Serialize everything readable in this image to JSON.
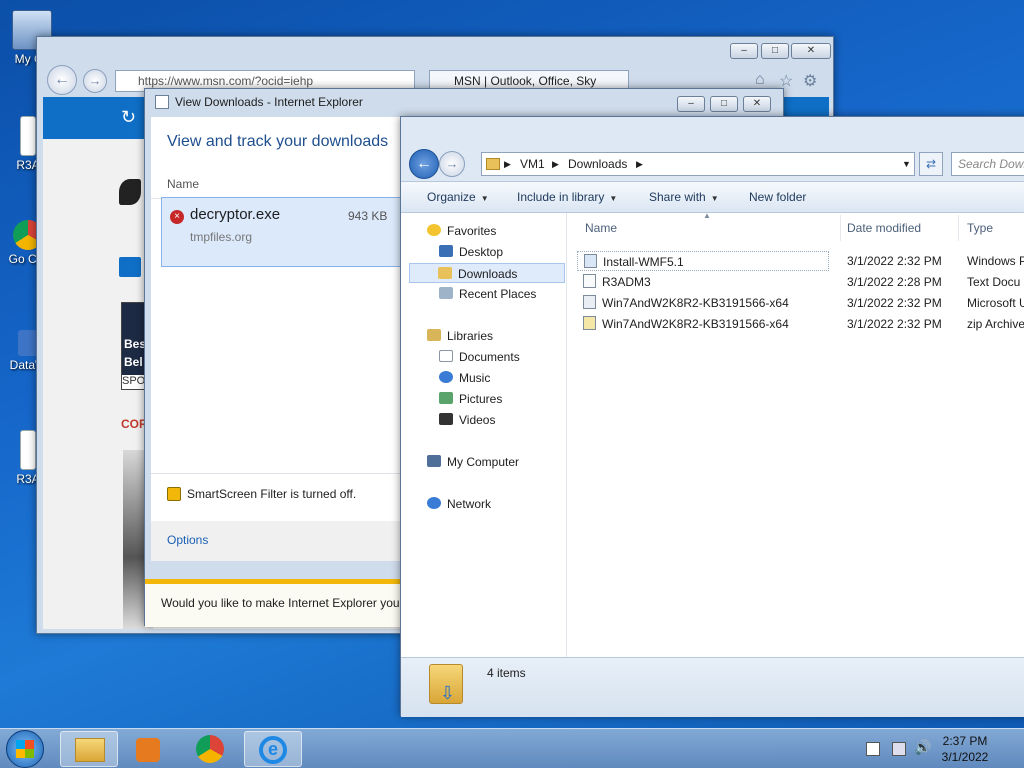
{
  "desktop": {
    "icons": [
      {
        "label": "My Co"
      },
      {
        "label": "R3A"
      },
      {
        "label": "Go Chr"
      },
      {
        "label": "DataW"
      },
      {
        "label": "R3A"
      }
    ]
  },
  "ie_window": {
    "address": "https://www.msn.com/?ocid=iehp",
    "tab_title": "MSN | Outlook, Office, Sky",
    "content": {
      "ad_text_1": "Bes",
      "ad_text_2": "Bel",
      "ad_text_3": "SPO",
      "section_label": "COR"
    },
    "notification": "Would you like to make Internet Explorer your"
  },
  "downloads_dialog": {
    "title": "View Downloads - Internet Explorer",
    "heading": "View and track your downloads",
    "column_name": "Name",
    "item": {
      "filename": "decryptor.exe",
      "size": "943 KB",
      "source": "tmpfiles.org"
    },
    "smartscreen": "SmartScreen Filter is turned off.",
    "options_link": "Options"
  },
  "explorer": {
    "breadcrumb": [
      "VM1",
      "Downloads"
    ],
    "search_placeholder": "Search Down",
    "toolbar": {
      "organize": "Organize",
      "include": "Include in library",
      "share": "Share with",
      "new_folder": "New folder"
    },
    "nav": {
      "favorites": "Favorites",
      "desktop": "Desktop",
      "downloads": "Downloads",
      "recent": "Recent Places",
      "libraries": "Libraries",
      "documents": "Documents",
      "music": "Music",
      "pictures": "Pictures",
      "videos": "Videos",
      "computer": "My Computer",
      "network": "Network"
    },
    "columns": {
      "name": "Name",
      "date": "Date modified",
      "type": "Type"
    },
    "files": [
      {
        "name": "Install-WMF5.1",
        "date": "3/1/2022 2:32 PM",
        "type": "Windows P"
      },
      {
        "name": "R3ADM3",
        "date": "3/1/2022 2:28 PM",
        "type": "Text Docu"
      },
      {
        "name": "Win7AndW2K8R2-KB3191566-x64",
        "date": "3/1/2022 2:32 PM",
        "type": "Microsoft U"
      },
      {
        "name": "Win7AndW2K8R2-KB3191566-x64",
        "date": "3/1/2022 2:32 PM",
        "type": "zip Archive"
      }
    ],
    "status": "4 items"
  },
  "taskbar": {
    "time": "2:37 PM",
    "date": "3/1/2022"
  }
}
